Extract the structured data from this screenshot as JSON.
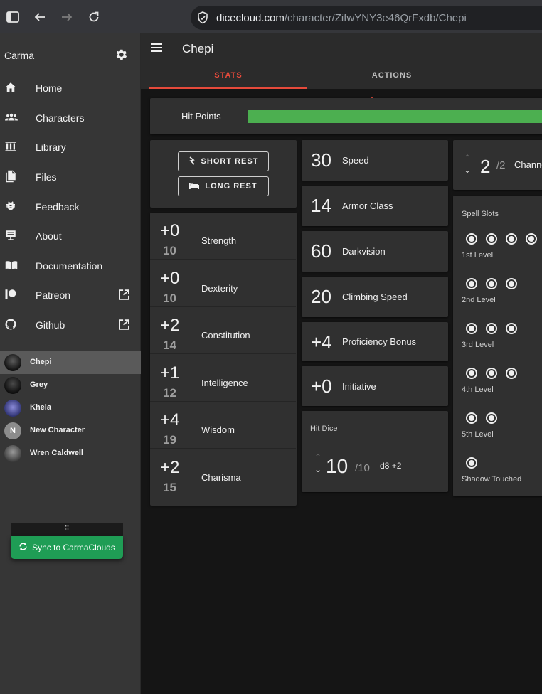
{
  "browser": {
    "url_host": "dicecloud.com",
    "url_path": "/character/ZifwYNY3e46QrFxdb/Chepi"
  },
  "sidebar": {
    "user": "Carma",
    "nav": [
      {
        "label": "Home",
        "icon": "home-icon"
      },
      {
        "label": "Characters",
        "icon": "people-icon"
      },
      {
        "label": "Library",
        "icon": "library-icon"
      },
      {
        "label": "Files",
        "icon": "file-icon"
      },
      {
        "label": "Feedback",
        "icon": "bug-icon"
      },
      {
        "label": "About",
        "icon": "about-icon"
      },
      {
        "label": "Documentation",
        "icon": "book-icon"
      },
      {
        "label": "Patreon",
        "icon": "patreon-icon",
        "external": true
      },
      {
        "label": "Github",
        "icon": "github-icon",
        "external": true
      }
    ],
    "characters": [
      {
        "name": "Chepi",
        "active": true
      },
      {
        "name": "Grey"
      },
      {
        "name": "Kheia"
      },
      {
        "name": "New Character",
        "initial": "N"
      },
      {
        "name": "Wren Caldwell"
      }
    ],
    "sync_handle": "⠿",
    "sync_label": "Sync to CarmaClouds"
  },
  "header": {
    "title": "Chepi",
    "tabs": [
      "STATS",
      "ACTIONS"
    ]
  },
  "hit_points": {
    "label": "Hit Points",
    "current_fraction": 1.0
  },
  "rest": {
    "short": "SHORT REST",
    "long": "LONG REST"
  },
  "abilities": [
    {
      "mod": "+0",
      "score": "10",
      "name": "Strength"
    },
    {
      "mod": "+0",
      "score": "10",
      "name": "Dexterity"
    },
    {
      "mod": "+2",
      "score": "14",
      "name": "Constitution"
    },
    {
      "mod": "+1",
      "score": "12",
      "name": "Intelligence"
    },
    {
      "mod": "+4",
      "score": "19",
      "name": "Wisdom"
    },
    {
      "mod": "+2",
      "score": "15",
      "name": "Charisma"
    }
  ],
  "stats": [
    {
      "value": "30",
      "name": "Speed"
    },
    {
      "value": "14",
      "name": "Armor Class"
    },
    {
      "value": "60",
      "name": "Darkvision"
    },
    {
      "value": "20",
      "name": "Climbing Speed"
    },
    {
      "value": "+4",
      "name": "Proficiency Bonus"
    },
    {
      "value": "+0",
      "name": "Initiative"
    }
  ],
  "hit_dice": {
    "label": "Hit Dice",
    "value": "10",
    "max": "/10",
    "dice": "d8 +2"
  },
  "channel": {
    "value": "2",
    "max": "/2",
    "name": "Channe"
  },
  "spell_slots": {
    "title": "Spell Slots",
    "levels": [
      {
        "name": "1st Level",
        "count": 4
      },
      {
        "name": "2nd Level",
        "count": 3
      },
      {
        "name": "3rd Level",
        "count": 3
      },
      {
        "name": "4th Level",
        "count": 3
      },
      {
        "name": "5th Level",
        "count": 2
      },
      {
        "name": "Shadow Touched",
        "count": 1
      }
    ]
  },
  "colors": {
    "accent": "#e64a3b",
    "hp": "#4caf50",
    "sync": "#1f9d55"
  }
}
